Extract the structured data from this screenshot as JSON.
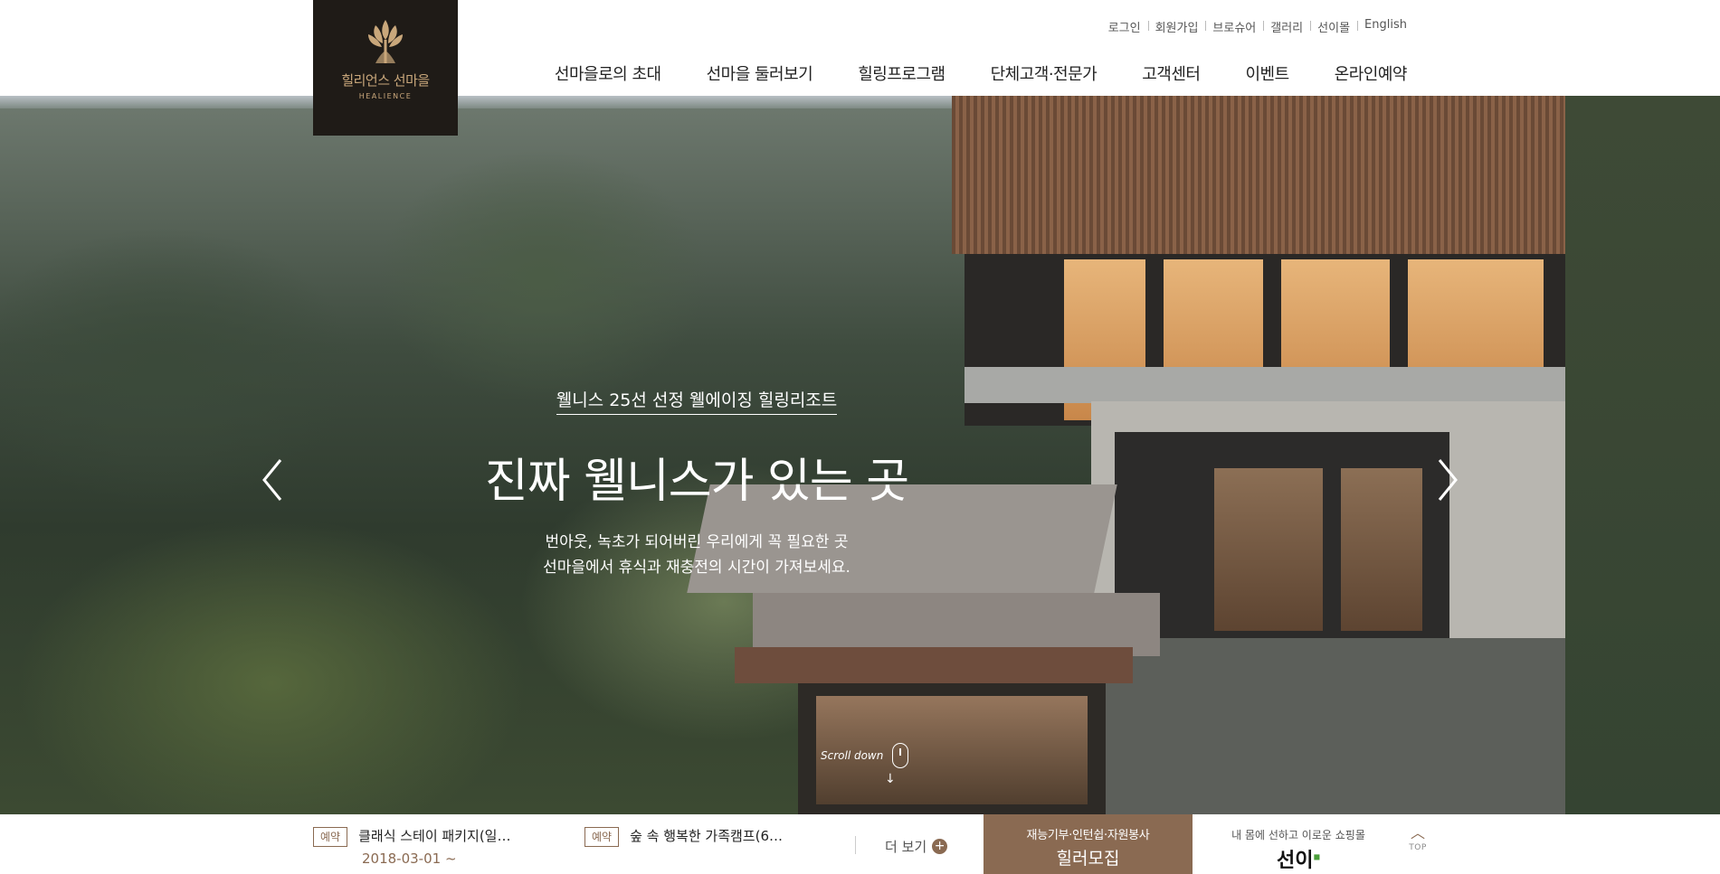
{
  "brand": {
    "name_ko": "힐리언스 선마을",
    "name_en": "HEALIENCE"
  },
  "util_menu": [
    "로그인",
    "회원가입",
    "브로슈어",
    "갤러리",
    "선이몰",
    "English"
  ],
  "gnb": [
    "선마을로의 초대",
    "선마을 둘러보기",
    "힐링프로그램",
    "단체고객·전문가",
    "고객센터",
    "이벤트",
    "온라인예약"
  ],
  "hero": {
    "eyebrow": "웰니스 25선 선정 웰에이징 힐링리조트",
    "headline": "진짜 웰니스가 있는 곳",
    "desc_line1": "번아웃, 녹초가 되어버린 우리에게 꼭 필요한 곳",
    "desc_line2": "선마을에서 휴식과 재충전의 시간이 가져보세요.",
    "scroll_label": "Scroll down"
  },
  "notices": [
    {
      "badge": "예약",
      "title": "클래식 스테이 패키지(일…",
      "date": "2018-03-01 ~"
    },
    {
      "badge": "예약",
      "title": "숲 속 행복한 가족캠프(6…"
    }
  ],
  "more_label": "더 보기",
  "recruit": {
    "sub": "재능기부·인턴쉽·자원봉사",
    "title": "힐러모집"
  },
  "shop": {
    "sub": "내 몸에 선하고 이로운 쇼핑몰",
    "title": "선이"
  },
  "top_label": "TOP",
  "colors": {
    "accent": "#8a6a52",
    "logo_bg": "#1f1b17",
    "logo_gold": "#c9a77b"
  }
}
